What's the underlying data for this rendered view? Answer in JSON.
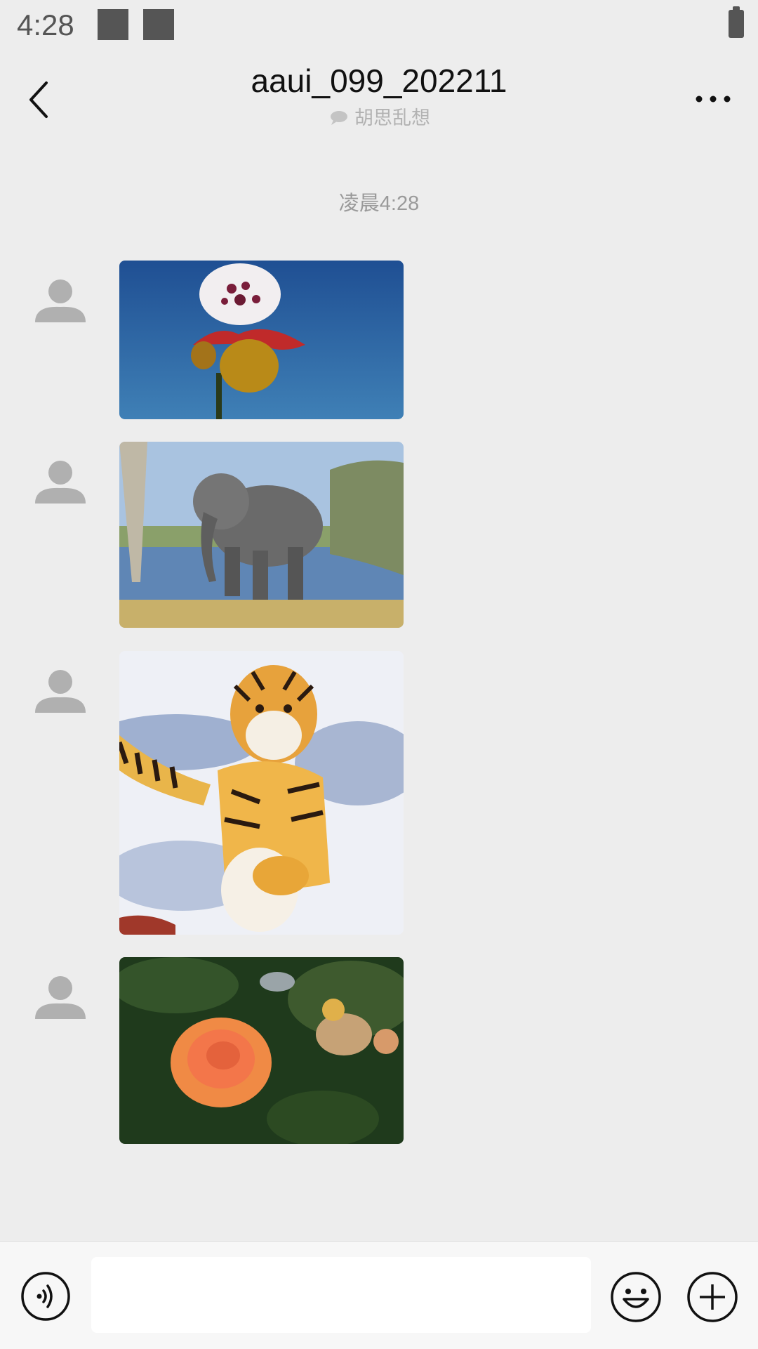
{
  "status_bar": {
    "time": "4:28"
  },
  "chat": {
    "title": "aaui_099_202211",
    "subtitle": "胡思乱想"
  },
  "timestamp": "凌晨4:28",
  "messages": [
    {
      "type": "image",
      "subject": "orchid-flower"
    },
    {
      "type": "image",
      "subject": "elephant"
    },
    {
      "type": "image",
      "subject": "tiger-in-snow"
    },
    {
      "type": "image",
      "subject": "orange-rose"
    }
  ],
  "input": {
    "value": "",
    "placeholder": ""
  },
  "icons": {
    "back": "back-arrow-icon",
    "more": "more-dots-icon",
    "voice": "voice-icon",
    "emoji": "emoji-icon",
    "plus": "plus-icon",
    "subtitle": "chat-bubble-icon"
  }
}
